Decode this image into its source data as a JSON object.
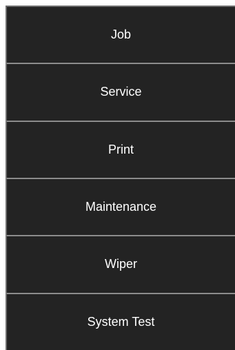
{
  "menu": {
    "items": [
      {
        "label": "Job"
      },
      {
        "label": "Service"
      },
      {
        "label": "Print"
      },
      {
        "label": "Maintenance"
      },
      {
        "label": "Wiper"
      },
      {
        "label": "System Test"
      }
    ]
  },
  "colors": {
    "button_background": "#232323",
    "divider": "#8c8c8c",
    "text": "#ffffff"
  }
}
